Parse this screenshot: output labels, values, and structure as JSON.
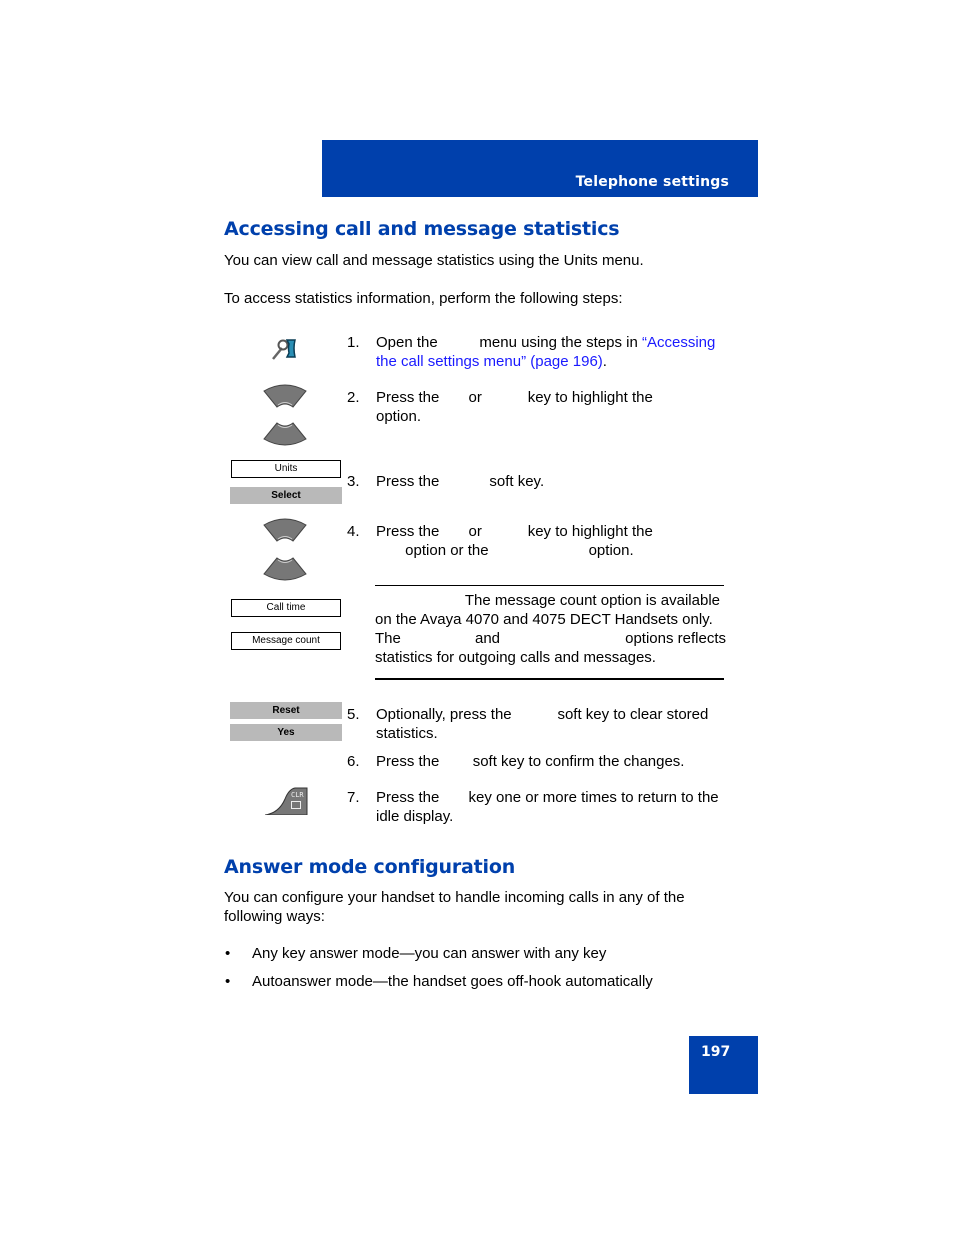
{
  "header": {
    "section_title": "Telephone settings"
  },
  "section1": {
    "heading": "Accessing call and message statistics",
    "intro": "You can view call and message statistics using the Units menu.",
    "lead": "To access statistics information, perform the following steps:",
    "steps": [
      {
        "num": "1.",
        "text_before": "Open the          menu using the steps in ",
        "link": "“Accessing the call settings menu” (page 196)",
        "text_after": "."
      },
      {
        "num": "2.",
        "line1": "Press the       or           key to highlight the",
        "line2": "option."
      },
      {
        "num": "3.",
        "line1": "Press the            soft key."
      },
      {
        "num": "4.",
        "line1": "Press the       or           key to highlight the",
        "line2": "       option or the                        option."
      },
      {
        "num": "5.",
        "line1": "Optionally, press the           soft key to clear stored",
        "line2": "statistics."
      },
      {
        "num": "6.",
        "line1": "Press the        soft key to confirm the changes."
      },
      {
        "num": "7.",
        "line1": "Press the       key one or more times to return to the",
        "line2": "idle display."
      }
    ],
    "note": {
      "line1": "The message count option is available",
      "line2": "on the Avaya 4070 and 4075 DECT Handsets only.",
      "line3_a": "The",
      "line3_b": "and",
      "line3_c": "options reflects",
      "line4": "statistics for outgoing calls and messages."
    },
    "icons": {
      "settings": "settings-wrench-phone-icon",
      "nav_up": "navigation-up-key-icon",
      "nav_down": "navigation-down-key-icon",
      "clear_key": "clr-key-icon",
      "clear_key_label": "CLR"
    },
    "display_items": {
      "units": "Units",
      "call_time": "Call time",
      "message_count": "Message count"
    },
    "soft_keys": {
      "select": "Select",
      "reset": "Reset",
      "yes": "Yes"
    }
  },
  "section2": {
    "heading": "Answer mode configuration",
    "intro_line1": "You can configure your handset to handle incoming calls in any of the",
    "intro_line2": "following ways:",
    "bullets": [
      "Any key answer mode—you can answer with any key",
      "Autoanswer mode—the handset goes off-hook automatically"
    ],
    "bullet_char": "•"
  },
  "footer": {
    "page_number": "197"
  }
}
